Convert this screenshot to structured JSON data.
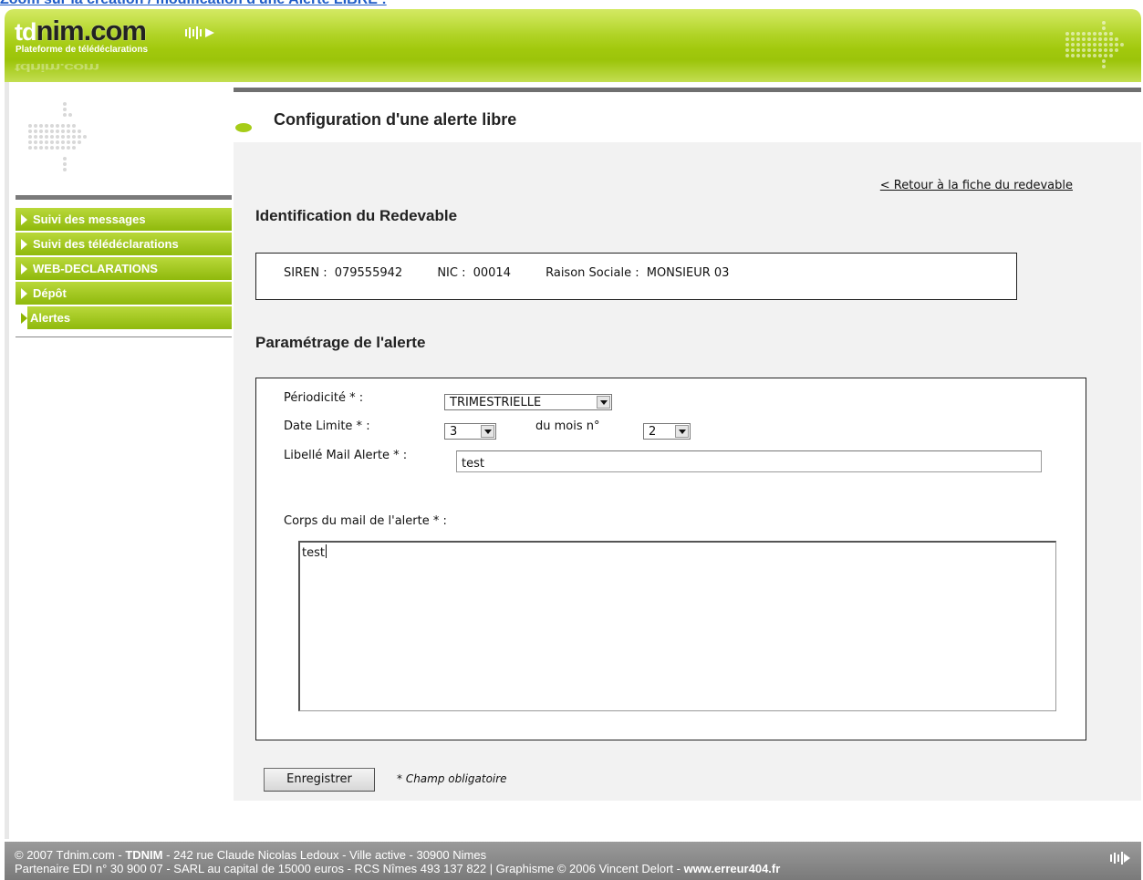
{
  "top_link": "Zoom sur la création / modification d'une Alerte LIBRE :",
  "logo": {
    "td": "td",
    "nim": "nim.com",
    "subtitle": "Plateforme de télédéclarations",
    "reflection": "tdnim.com"
  },
  "sidebar": {
    "items": [
      {
        "label": "Suivi des messages",
        "active": false
      },
      {
        "label": "Suivi des télédéclarations",
        "active": false
      },
      {
        "label": "WEB-DECLARATIONS",
        "active": false
      },
      {
        "label": "Dépôt",
        "active": false
      },
      {
        "label": "Alertes",
        "active": true
      }
    ]
  },
  "main": {
    "title": "Configuration d'une alerte libre",
    "back_link": "< Retour à la fiche du redevable",
    "identification": {
      "heading": "Identification du Redevable",
      "siren_label": "SIREN :",
      "siren_value": "079555942",
      "nic_label": "NIC :",
      "nic_value": "00014",
      "raison_label": "Raison Sociale :",
      "raison_value": "MONSIEUR 03"
    },
    "parametrage": {
      "heading": "Paramétrage de l'alerte",
      "periodicite_label": "Périodicité * :",
      "periodicite_value": "TRIMESTRIELLE",
      "date_limite_label": "Date Limite * :",
      "date_limite_value": "3",
      "du_mois_label": "du mois n°",
      "du_mois_value": "2",
      "libelle_label": "Libellé Mail Alerte * :",
      "libelle_value": "test",
      "corps_label": "Corps du mail de l'alerte * :",
      "corps_value": "test"
    },
    "save_button": "Enregistrer",
    "required_note": "* Champ obligatoire"
  },
  "footer": {
    "line1_a": "© 2007 Tdnim.com - ",
    "line1_b": "TDNIM",
    "line1_c": " - 242 rue Claude Nicolas Ledoux - Ville active - 30900 Nimes",
    "line2_a": "Partenaire EDI n° 30 900 07 - SARL au capital de 15000 euros - RCS Nîmes 493 137 822 | Graphisme © 2006 Vincent Delort - ",
    "line2_b": "www.erreur404.fr"
  },
  "colors": {
    "accent_green": "#9cc40a",
    "footer_gray": "#8a8a8a",
    "link_blue": "#1f5cc7"
  }
}
